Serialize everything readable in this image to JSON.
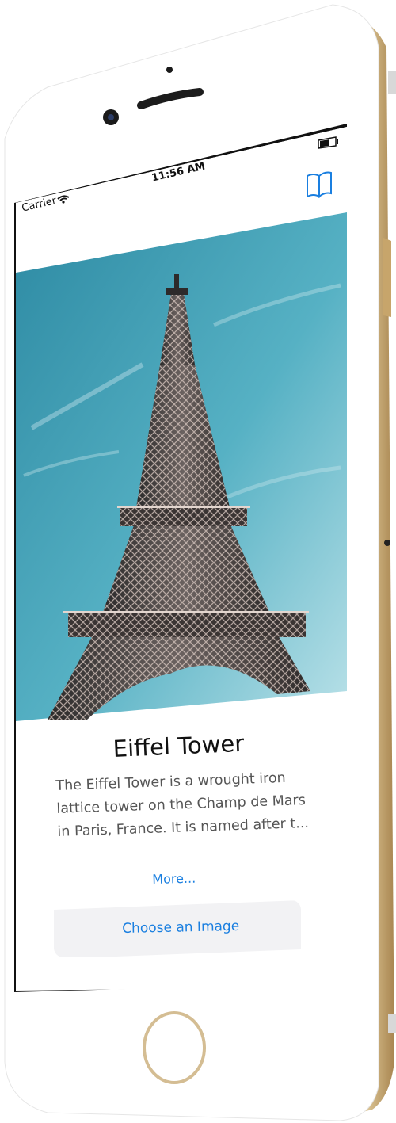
{
  "status_bar": {
    "carrier": "Carrier",
    "time": "11:56 AM"
  },
  "nav": {
    "icon": "book-icon"
  },
  "landmark": {
    "title": "Eiffel Tower",
    "description": "The Eiffel Tower is a wrought iron lattice tower on the Champ de Mars in Paris, France. It is named after t...",
    "more_label": "More...",
    "choose_label": "Choose an Image"
  },
  "colors": {
    "accent": "#1a7fe0",
    "phone_gold": "#d9c39a",
    "sky": "#3fa0b5"
  }
}
